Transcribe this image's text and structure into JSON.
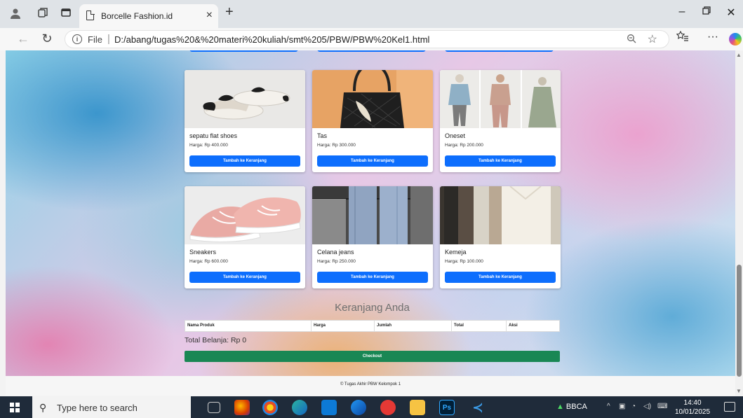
{
  "browser": {
    "tab_title": "Borcelle Fashion.id",
    "address_label": "File",
    "url": "D:/abang/tugas%20&%20materi%20kuliah/smt%205/PBW/PBW%20Kel1.html"
  },
  "products": [
    {
      "name": "sepatu flat shoes",
      "price": "Harga: Rp 400.000",
      "button": "Tambah ke Keranjang"
    },
    {
      "name": "Tas",
      "price": "Harga: Rp 300.000",
      "button": "Tambah ke Keranjang"
    },
    {
      "name": "Oneset",
      "price": "Harga: Rp 200.000",
      "button": "Tambah ke Keranjang"
    },
    {
      "name": "Sneakers",
      "price": "Harga: Rp 600.000",
      "button": "Tambah ke Keranjang"
    },
    {
      "name": "Celana jeans",
      "price": "Harga: Rp 250.000",
      "button": "Tambah ke Keranjang"
    },
    {
      "name": "Kemeja",
      "price": "Harga: Rp 100.000",
      "button": "Tambah ke Keranjang"
    }
  ],
  "cart": {
    "heading": "Keranjang Anda",
    "columns": [
      "Nama Produk",
      "Harga",
      "Jumlah",
      "Total",
      "Aksi"
    ],
    "total": "Total Belanja: Rp 0",
    "checkout": "Checkout"
  },
  "footer": {
    "text": "© Tugas Akhir PBW Kelompok 1"
  },
  "taskbar": {
    "search_placeholder": "Type here to search",
    "stock_label": "BBCA",
    "time": "14:40",
    "date": "10/01/2025",
    "app_ps": "Ps"
  },
  "colors": {
    "primary_button": "#0d6efd",
    "checkout_button": "#198754"
  }
}
